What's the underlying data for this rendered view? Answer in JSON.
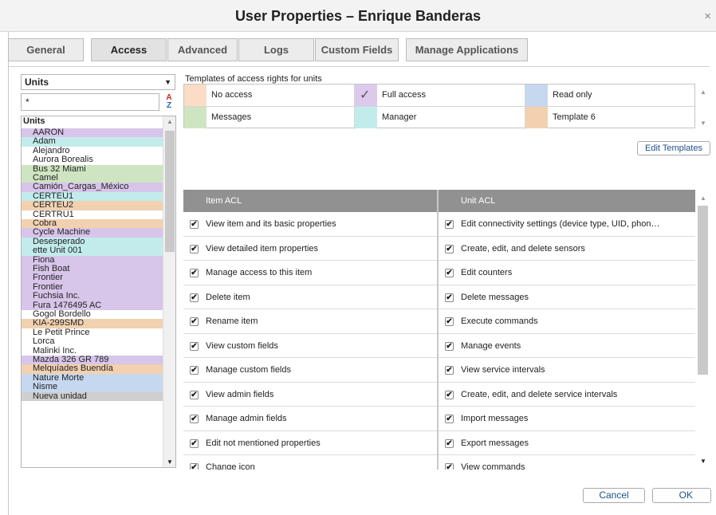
{
  "window": {
    "title": "User Properties – Enrique Banderas",
    "close_glyph": "×"
  },
  "tabs": [
    {
      "label": "General",
      "active": false
    },
    {
      "label": "Access",
      "active": true
    },
    {
      "label": "Advanced",
      "active": false
    },
    {
      "label": "Logs",
      "active": false
    },
    {
      "label": "Custom Fields",
      "active": false
    },
    {
      "label": "Manage Applications",
      "active": false
    }
  ],
  "units_panel": {
    "selector_value": "Units",
    "filter_value": "*",
    "sort_icon": "sort-a-z-icon",
    "sort_a": "A",
    "sort_z": "Z",
    "list_header": "Units",
    "items": [
      {
        "name": "AARON",
        "color": "#d8c5ea"
      },
      {
        "name": "Adam",
        "color": "#c2ecec"
      },
      {
        "name": "Alejandro",
        "color": "#ffffff"
      },
      {
        "name": "Aurora Borealis",
        "color": "#ffffff"
      },
      {
        "name": "Bus 32 Miami",
        "color": "#cfe5c2"
      },
      {
        "name": "Camel",
        "color": "#cfe5c2"
      },
      {
        "name": "Camión_Cargas_México",
        "color": "#d8c5ea"
      },
      {
        "name": "CERTEU1",
        "color": "#c2ecec"
      },
      {
        "name": "CERTEU2",
        "color": "#f2d1b0"
      },
      {
        "name": "CERTRU1",
        "color": "#ffffff"
      },
      {
        "name": "Cobra",
        "color": "#f2d1b0"
      },
      {
        "name": "Cycle Machine",
        "color": "#d8c5ea"
      },
      {
        "name": "Desesperado",
        "color": "#c2ecec"
      },
      {
        "name": "ette Unit 001",
        "color": "#c2ecec"
      },
      {
        "name": "Fiona",
        "color": "#d8c5ea"
      },
      {
        "name": "Fish Boat",
        "color": "#d8c5ea"
      },
      {
        "name": "Frontier",
        "color": "#d8c5ea"
      },
      {
        "name": "Frontier",
        "color": "#d8c5ea"
      },
      {
        "name": "Fuchsia Inc.",
        "color": "#d8c5ea"
      },
      {
        "name": "Fura 1476495 AC",
        "color": "#d8c5ea"
      },
      {
        "name": "Gogol Bordello",
        "color": "#ffffff"
      },
      {
        "name": "KIA-299SMD",
        "color": "#f2d1b0"
      },
      {
        "name": "Le Petit Prince",
        "color": "#ffffff"
      },
      {
        "name": "Lorca",
        "color": "#ffffff"
      },
      {
        "name": "Malinki Inc.",
        "color": "#ffffff"
      },
      {
        "name": "Mazda 326 GR 789",
        "color": "#d8c5ea"
      },
      {
        "name": "Melquíades Buendía",
        "color": "#f2d1b0"
      },
      {
        "name": "Nature Morte",
        "color": "#c6d8f0"
      },
      {
        "name": "Nisme",
        "color": "#c6d8f0"
      },
      {
        "name": "Nueva unidad",
        "color": "#cfcfcf"
      }
    ]
  },
  "templates": {
    "caption": "Templates of access rights for units",
    "items": [
      {
        "label": "No access",
        "color": "#fbdcc7",
        "checked": false
      },
      {
        "label": "Full access",
        "color": "#dcc9ec",
        "checked": true
      },
      {
        "label": "Read only",
        "color": "#c6d8f0",
        "checked": false
      },
      {
        "label": "Messages",
        "color": "#cfe5c2",
        "checked": false
      },
      {
        "label": "Manager",
        "color": "#c2ecec",
        "checked": false
      },
      {
        "label": "Template 6",
        "color": "#f2d1b0",
        "checked": false
      }
    ],
    "check_glyph": "✓",
    "edit_button": "Edit Templates"
  },
  "item_acl": {
    "header": "Item ACL",
    "rows": [
      {
        "label": "View item and its basic properties",
        "checked": true
      },
      {
        "label": "View detailed item properties",
        "checked": true
      },
      {
        "label": "Manage access to this item",
        "checked": true
      },
      {
        "label": "Delete item",
        "checked": true
      },
      {
        "label": "Rename item",
        "checked": true
      },
      {
        "label": "View custom fields",
        "checked": true
      },
      {
        "label": "Manage custom fields",
        "checked": true
      },
      {
        "label": "View admin fields",
        "checked": true
      },
      {
        "label": "Manage admin fields",
        "checked": true
      },
      {
        "label": "Edit not mentioned properties",
        "checked": true
      },
      {
        "label": "Change icon",
        "checked": true
      }
    ]
  },
  "unit_acl": {
    "header": "Unit ACL",
    "rows": [
      {
        "label": "Edit connectivity settings (device type, UID, phon…",
        "checked": true
      },
      {
        "label": "Create, edit, and delete sensors",
        "checked": true
      },
      {
        "label": "Edit counters",
        "checked": true
      },
      {
        "label": "Delete messages",
        "checked": true
      },
      {
        "label": "Execute commands",
        "checked": true
      },
      {
        "label": "Manage events",
        "checked": true
      },
      {
        "label": "View service intervals",
        "checked": true
      },
      {
        "label": "Create, edit, and delete service intervals",
        "checked": true
      },
      {
        "label": "Import messages",
        "checked": true
      },
      {
        "label": "Export messages",
        "checked": true
      },
      {
        "label": "View commands",
        "checked": true
      }
    ]
  },
  "checkbox_glyph": "✔",
  "scroll_up_glyph": "▲",
  "scroll_down_glyph": "▼",
  "footer": {
    "cancel": "Cancel",
    "ok": "OK"
  }
}
